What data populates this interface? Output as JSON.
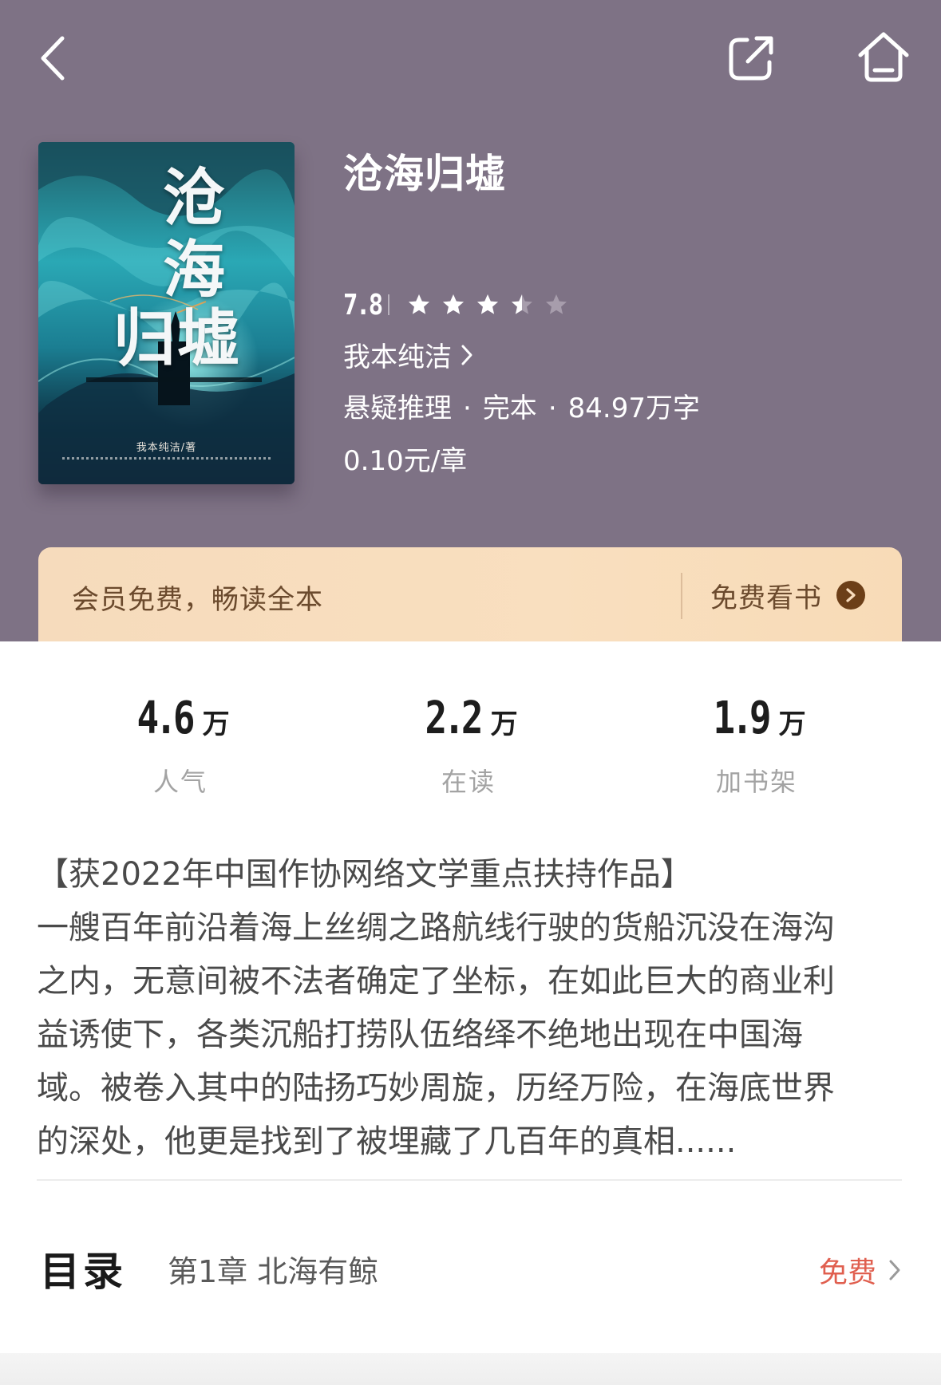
{
  "book": {
    "title": "沧海归墟",
    "cover_title_line1": "沧海",
    "cover_title_line2": "归墟",
    "cover_author": "我本纯洁/著",
    "rating": "7.8",
    "rating_stars": 3.5,
    "author": "我本纯洁",
    "genre": "悬疑推理",
    "status": "完本",
    "word_count": "84.97万字",
    "meta_separator": "·",
    "price": "0.10元/章"
  },
  "vip_banner": {
    "text": "会员免费，畅读全本",
    "button_label": "免费看书"
  },
  "stats": [
    {
      "value": "4.6",
      "unit": "万",
      "label": "人气"
    },
    {
      "value": "2.2",
      "unit": "万",
      "label": "在读"
    },
    {
      "value": "1.9",
      "unit": "万",
      "label": "加书架"
    }
  ],
  "intro": {
    "lines": [
      "【获2022年中国作协网络文学重点扶持作品】",
      "一艘百年前沿着海上丝绸之路航线行驶的货船沉没在海沟",
      "之内，无意间被不法者确定了坐标，在如此巨大的商业利",
      "益诱使下，各类沉船打捞队伍络绎不绝地出现在中国海",
      "域。被卷入其中的陆扬巧妙周旋，历经万险，在海底世界",
      "的深处，他更是找到了被埋藏了几百年的真相......"
    ]
  },
  "toc": {
    "title": "目录",
    "first_chapter": "第1章 北海有鲸",
    "free_label": "免费"
  },
  "colors": {
    "header_bg": "#7e7285",
    "vip_banner_bg": "#f8dcbc",
    "vip_text": "#6b4a2d",
    "free_label": "#e05f4f",
    "star_filled": "#ffffff",
    "star_empty": "#a79dac"
  },
  "icons": {
    "back": "chevron-left-icon",
    "share": "share-external-icon",
    "home": "home-icon"
  }
}
